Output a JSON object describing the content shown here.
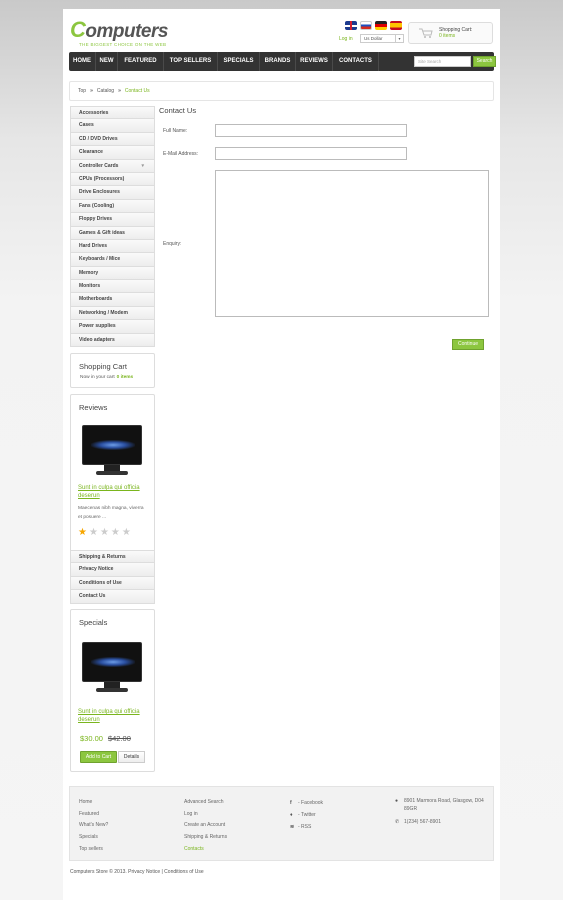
{
  "header": {
    "logo_main": "omputers",
    "logo_first_letter": "C",
    "logo_tagline": "THE BIGGEST CHOICE ON THE WEB",
    "login_label": "Log in",
    "currency": "Us Dollar",
    "cart_title": "Shopping Cart:",
    "cart_items": "0 items"
  },
  "nav": {
    "items": [
      "HOME",
      "NEW",
      "FEATURED",
      "TOP SELLERS",
      "SPECIALS",
      "BRANDS",
      "REVIEWS",
      "CONTACTS"
    ],
    "search_placeholder": "Site Search",
    "search_button": "Search"
  },
  "breadcrumb": [
    "Top",
    "Catalog",
    "Contact Us"
  ],
  "categories": [
    "Accessories",
    "Cases",
    "CD / DVD Drives",
    "Clearance",
    "Controller Cards",
    "CPUs (Processors)",
    "Drive Enclosures",
    "Fans (Cooling)",
    "Floppy Drives",
    "Games & Gift ideas",
    "Hard Drives",
    "Keyboards / Mice",
    "Memory",
    "Monitors",
    "Motherboards",
    "Networking / Modem",
    "Power supplies",
    "Video adapters"
  ],
  "shopping_cart": {
    "title": "Shopping Cart",
    "text": "Now in your cart",
    "count": "0 items"
  },
  "reviews": {
    "title": "Reviews",
    "product_name": "Sunt in culpa qui officia deserun",
    "text": "Maecenas nibh magna, viverra et posuere ...",
    "rating": 1,
    "rating_max": 5
  },
  "info_links": [
    "Shipping & Returns",
    "Privacy Notice",
    "Conditions of Use",
    "Contact Us"
  ],
  "specials": {
    "title": "Specials",
    "product_name": "Sunt in culpa qui officia deserun",
    "price_new": "$30.00",
    "price_old": "$42.00",
    "add_to_cart": "Add to Cart",
    "details": "Details"
  },
  "contact": {
    "title": "Contact Us",
    "full_name_label": "Full Name:",
    "email_label": "E-Mail Address:",
    "enquiry_label": "Enquiry:",
    "full_name_value": "",
    "email_value": "",
    "enquiry_value": "",
    "continue_button": "Continue"
  },
  "footer": {
    "col1": [
      "Home",
      "Featured",
      "What's New?",
      "Specials",
      "Top sellers"
    ],
    "col2": [
      "Advanced Search",
      "Log in",
      "Create an Account",
      "Shipping & Returns",
      "Contacts"
    ],
    "social": [
      "- Facebook",
      "- Twitter",
      "- RSS"
    ],
    "address": "8901 Marmora Road, Glasgow, D04 89GR",
    "phone": "1(234) 567-8901",
    "copyright": "Computers Store  © 2013. Privacy Notice  |  Conditions of Use"
  },
  "colors": {
    "accent": "#8cc63f",
    "nav_bg": "#333333"
  }
}
